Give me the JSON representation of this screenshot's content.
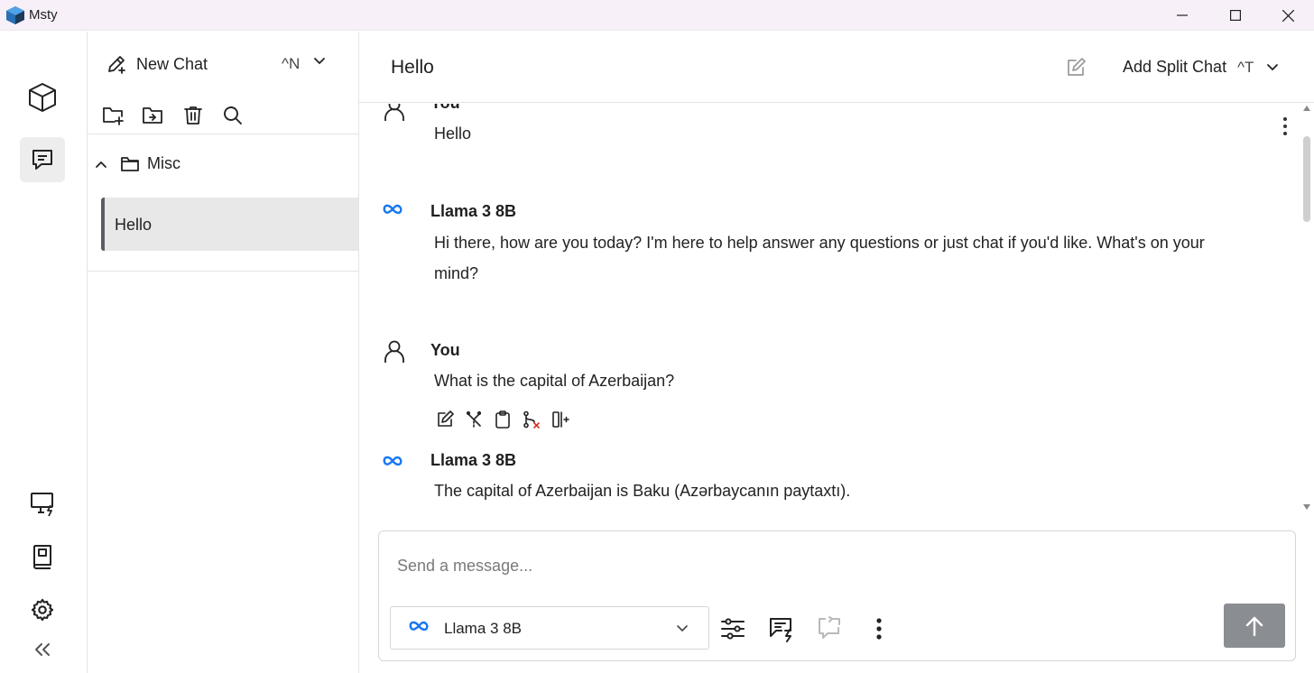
{
  "app": {
    "title": "Msty"
  },
  "sidebar": {
    "new_chat_label": "New Chat",
    "new_chat_shortcut": "^N",
    "folder_name": "Misc",
    "chats": [
      {
        "title": "Hello"
      }
    ]
  },
  "main": {
    "title": "Hello",
    "split_label": "Add Split Chat",
    "split_shortcut": "^T"
  },
  "messages": [
    {
      "author": "You",
      "text": "Hello"
    },
    {
      "author": "Llama 3 8B",
      "text": "Hi there, how are you today? I'm here to help answer any questions or just chat if you'd like. What's on your mind?"
    },
    {
      "author": "You",
      "text": "What is the capital of Azerbaijan?"
    },
    {
      "author": "Llama 3 8B",
      "text": "The capital of Azerbaijan is Baku (Azərbaycanın paytaxtı)."
    }
  ],
  "composer": {
    "placeholder": "Send a message...",
    "model": "Llama 3 8B"
  },
  "colors": {
    "accent_meta": "#1877f2",
    "send_button": "#8a8d91",
    "active_item_bg": "#e8e8e8"
  },
  "icons": [
    "cube-icon",
    "chat-icon",
    "monitor-bolt-icon",
    "book-icon",
    "gear-icon",
    "collapse-icon"
  ]
}
